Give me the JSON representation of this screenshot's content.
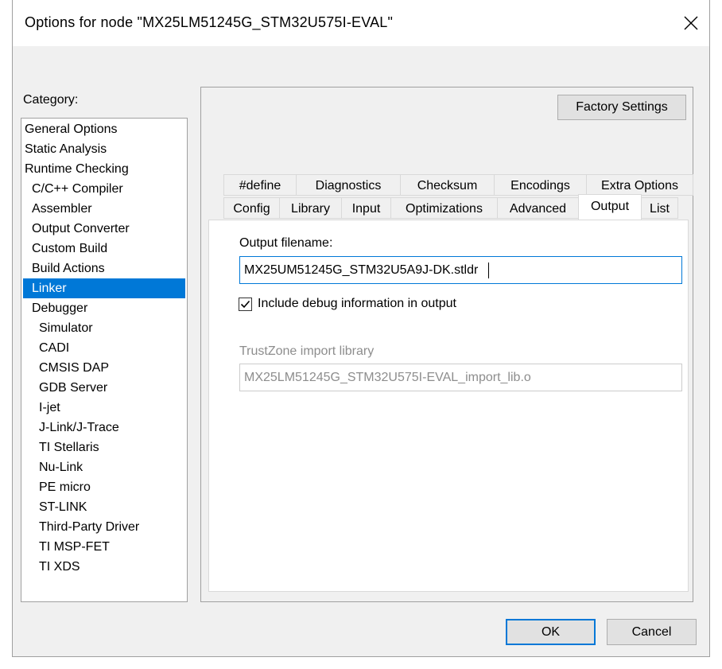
{
  "window": {
    "title": "Options for node \"MX25LM51245G_STM32U575I-EVAL\""
  },
  "icons": {
    "close": "close-icon",
    "checkbox": "checkmark-icon"
  },
  "category": {
    "label": "Category:",
    "selected": "Linker",
    "items": [
      {
        "label": "General Options",
        "level": 0
      },
      {
        "label": "Static Analysis",
        "level": 0
      },
      {
        "label": "Runtime Checking",
        "level": 0
      },
      {
        "label": "C/C++ Compiler",
        "level": 1
      },
      {
        "label": "Assembler",
        "level": 1
      },
      {
        "label": "Output Converter",
        "level": 1
      },
      {
        "label": "Custom Build",
        "level": 1
      },
      {
        "label": "Build Actions",
        "level": 1
      },
      {
        "label": "Linker",
        "level": 1
      },
      {
        "label": "Debugger",
        "level": 1
      },
      {
        "label": "Simulator",
        "level": 2
      },
      {
        "label": "CADI",
        "level": 2
      },
      {
        "label": "CMSIS DAP",
        "level": 2
      },
      {
        "label": "GDB Server",
        "level": 2
      },
      {
        "label": "I-jet",
        "level": 2
      },
      {
        "label": "J-Link/J-Trace",
        "level": 2
      },
      {
        "label": "TI Stellaris",
        "level": 2
      },
      {
        "label": "Nu-Link",
        "level": 2
      },
      {
        "label": "PE micro",
        "level": 2
      },
      {
        "label": "ST-LINK",
        "level": 2
      },
      {
        "label": "Third-Party Driver",
        "level": 2
      },
      {
        "label": "TI MSP-FET",
        "level": 2
      },
      {
        "label": "TI XDS",
        "level": 2
      }
    ]
  },
  "buttons": {
    "factory_settings": "Factory Settings",
    "ok": "OK",
    "cancel": "Cancel"
  },
  "tabs": {
    "row1": [
      "#define",
      "Diagnostics",
      "Checksum",
      "Encodings",
      "Extra Options"
    ],
    "row2": [
      "Config",
      "Library",
      "Input",
      "Optimizations",
      "Advanced",
      "Output",
      "List"
    ],
    "active": "Output"
  },
  "output": {
    "filename_label": "Output filename:",
    "filename_value": "MX25UM51245G_STM32U5A9J-DK.stldr",
    "include_debug_label": "Include debug information in output",
    "include_debug_checked": true,
    "trustzone_label": "TrustZone import library",
    "trustzone_value": "MX25LM51245G_STM32U575I-EVAL_import_lib.o",
    "trustzone_enabled": false
  }
}
